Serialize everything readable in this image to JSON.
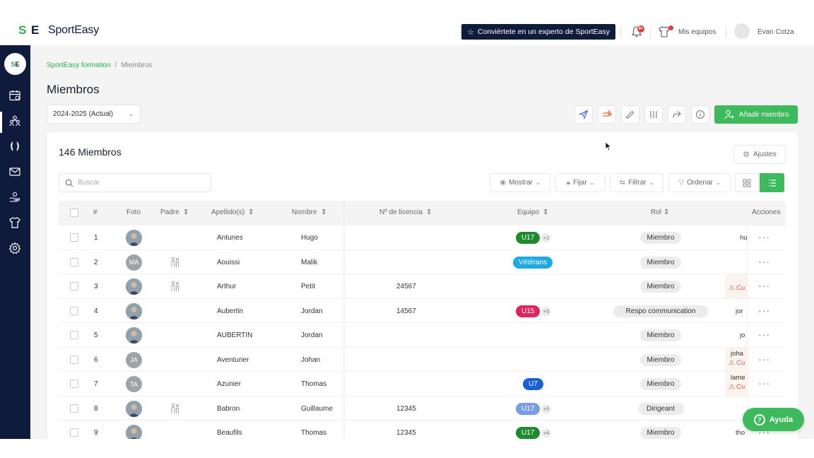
{
  "brand": {
    "name": "SportEasy",
    "mark_s": "S",
    "mark_e": "E",
    "side_mark_s": "S",
    "side_mark_e": "E"
  },
  "topbar": {
    "expert_label": "Conviértete en un experto de SportEasy",
    "notif_badge": "9+",
    "teams_label": "Mis equipos",
    "user_name": "Evan Cotza"
  },
  "breadcrumb": {
    "root": "SportEasy formation",
    "separator": "/",
    "current": "Miembros"
  },
  "page": {
    "title": "Miembros",
    "season": "2024-2025 (Actual)",
    "add_member": "Añadir miembro"
  },
  "card": {
    "count": "146 Miembros",
    "settings": "Ajustes",
    "search_placeholder": "Buscar",
    "filters": {
      "show": "Mostrar",
      "pin": "Fijar",
      "filter": "Filtrar",
      "sort": "Ordenar"
    }
  },
  "table": {
    "headers": {
      "num": "#",
      "photo": "Foto",
      "parent": "Padre",
      "surname": "Apellido(s)",
      "name": "Nombre",
      "license": "Nº de licencia",
      "team": "Equipo",
      "role": "Rol",
      "actions": "Acciones"
    },
    "rows": [
      {
        "n": "1",
        "initials": "",
        "parent": false,
        "surname": "Antunes",
        "name": "Hugo",
        "license": "",
        "team": "U17",
        "team_color": "#1e8a2f",
        "extra": "+1",
        "role": "Miembro",
        "right": "hu",
        "alert": ""
      },
      {
        "n": "2",
        "initials": "MA",
        "parent": true,
        "surname": "Aouissi",
        "name": "Malik",
        "license": "",
        "team": "Vétérans",
        "team_color": "#20a9e0",
        "extra": "",
        "role": "Miembro",
        "right": "",
        "alert": ""
      },
      {
        "n": "3",
        "initials": "",
        "parent": true,
        "surname": "Arthur",
        "name": "Petit",
        "license": "24567",
        "team": "",
        "team_color": "",
        "extra": "",
        "role": "Miembro",
        "right": "",
        "alert": "Cu"
      },
      {
        "n": "4",
        "initials": "",
        "parent": false,
        "surname": "Aubertin",
        "name": "Jordan",
        "license": "14567",
        "team": "U15",
        "team_color": "#e0245e",
        "extra": "+5",
        "role": "Respo communication",
        "right": "jor",
        "alert": ""
      },
      {
        "n": "5",
        "initials": "",
        "parent": false,
        "surname": "AUBERTIN",
        "name": "Jordan",
        "license": "",
        "team": "",
        "team_color": "",
        "extra": "",
        "role": "Miembro",
        "right": "jo",
        "alert": ""
      },
      {
        "n": "6",
        "initials": "JA",
        "parent": false,
        "surname": "Aventurier",
        "name": "Johan",
        "license": "",
        "team": "",
        "team_color": "",
        "extra": "",
        "role": "Miembro",
        "right": "joha",
        "alert": "Cu"
      },
      {
        "n": "7",
        "initials": "TA",
        "parent": false,
        "surname": "Azunier",
        "name": "Thomas",
        "license": "",
        "team": "U7",
        "team_color": "#1a5fd6",
        "extra": "",
        "role": "Miembro",
        "right": "lame",
        "alert": "Cu"
      },
      {
        "n": "8",
        "initials": "",
        "parent": true,
        "surname": "Babron",
        "name": "Guillaume",
        "license": "12345",
        "team": "U17",
        "team_color": "#7a9be6",
        "extra": "+5",
        "role": "Dirigeant",
        "right": "",
        "alert": ""
      },
      {
        "n": "9",
        "initials": "",
        "parent": false,
        "surname": "Beaufils",
        "name": "Thomas",
        "license": "12345",
        "team": "U17",
        "team_color": "#1e8a2f",
        "extra": "+4",
        "role": "Miembro",
        "right": "tho",
        "alert": ""
      }
    ]
  },
  "help": {
    "label": "Ayuda",
    "q": "?"
  },
  "colors": {
    "navy": "#0f1b3d",
    "green": "#3dba5c",
    "brand_green": "#2bb24c"
  }
}
